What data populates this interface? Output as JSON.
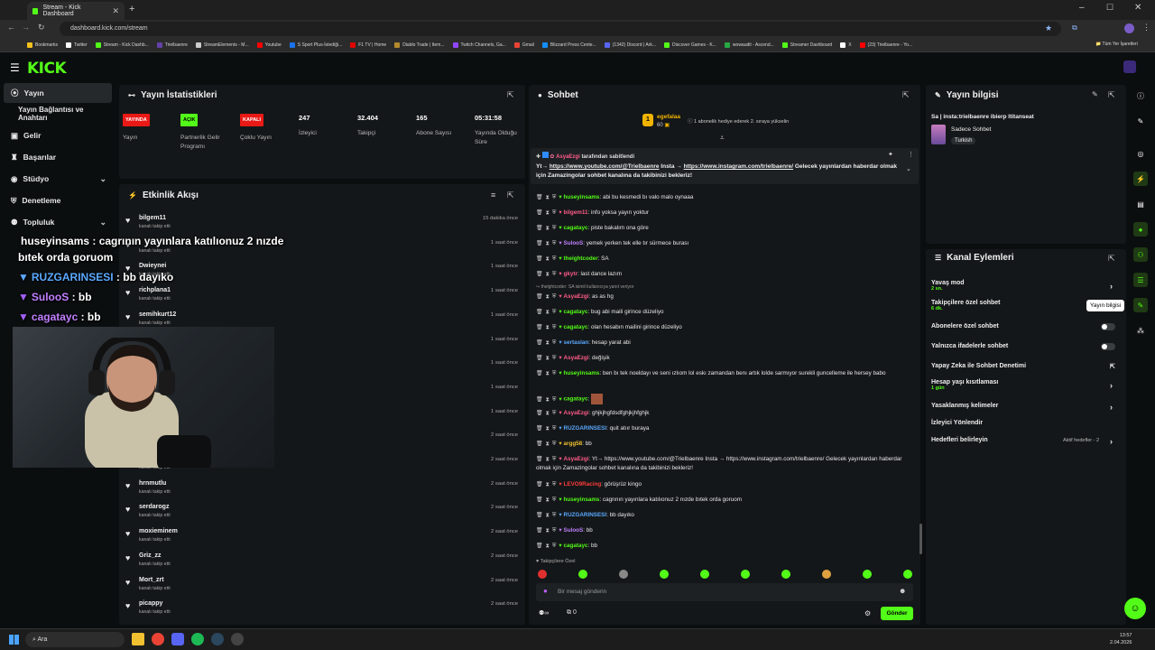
{
  "browser": {
    "tab_title": "Stream - Kick Dashboard",
    "url": "dashboard.kick.com/stream",
    "bookmarks": [
      "Bookmarks",
      "Twitter",
      "Stream - Kick Dashb...",
      "Trielbaenre",
      "StreamElements - M...",
      "Youtube",
      "S Sport Plus-İstediği...",
      "F1 TV | Home",
      "Diablo Trade | Item...",
      "Twitch Channels, Ga...",
      "Gmail",
      "Blizzard Press Cente...",
      "(1342) Discord | Ark...",
      "Discover Games - K...",
      "wowaudit - Ascend...",
      "Streamer Dashboard",
      "X",
      "(23) Trielbaenre - Yo..."
    ],
    "all_bookmarks": "Tüm Yer İşaretleri",
    "bookmark_colors": [
      "#f4c01e",
      "#ffffff",
      "#53fc18",
      "#6441a5",
      "#cccccc",
      "#ff0000",
      "#1a73e8",
      "#e10600",
      "#b48a2d",
      "#9146ff",
      "#ea4335",
      "#148eff",
      "#5865f2",
      "#53fc18",
      "#27a844",
      "#53fc18",
      "#ffffff",
      "#ff0000"
    ]
  },
  "app": {
    "logo": "KICK"
  },
  "sidebar": {
    "items": [
      {
        "label": "Yayın",
        "active": true
      },
      {
        "label": "Yayın Bağlantısı ve Anahtarı"
      },
      {
        "label": "Gelir"
      },
      {
        "label": "Başarılar"
      },
      {
        "label": "Stüdyo",
        "expand": "chevron-down"
      },
      {
        "label": "Denetleme"
      },
      {
        "label": "Topluluk",
        "expand": "chevron-down"
      }
    ]
  },
  "stats": {
    "title": "Yayın İstatistikleri",
    "items": [
      {
        "badge": "YAYINDA",
        "label": "Yayın",
        "badge_color": "#e91916"
      },
      {
        "badge": "AÇIK",
        "label": "Partnerlik Gelir Programı",
        "badge_color": "#53fc18"
      },
      {
        "badge": "KAPALI",
        "label": "Çoklu Yayın",
        "badge_color": "#e91916"
      },
      {
        "value": "247",
        "label": "İzleyici"
      },
      {
        "value": "32.404",
        "label": "Takipçi"
      },
      {
        "value": "165",
        "label": "Abone Sayısı"
      },
      {
        "value": "05:31:58",
        "label": "Yayında Olduğu Süre"
      }
    ]
  },
  "activity": {
    "title": "Etkinlik Akışı",
    "followed": "kanalı takip etti",
    "items": [
      {
        "name": "bilgem11",
        "time": "15 dakika önce"
      },
      {
        "name": "",
        "time": "1 saat önce"
      },
      {
        "name": "Dwieynei",
        "time": "1 saat önce"
      },
      {
        "name": "richplana1",
        "time": "1 saat önce"
      },
      {
        "name": "semihkurt12",
        "time": "1 saat önce"
      },
      {
        "name": "",
        "time": "1 saat önce"
      },
      {
        "name": "",
        "time": "1 saat önce"
      },
      {
        "name": "",
        "time": "1 saat önce"
      },
      {
        "name": "",
        "time": "1 saat önce"
      },
      {
        "name": "",
        "time": "2 saat önce"
      },
      {
        "name": "",
        "time": "2 saat önce"
      },
      {
        "name": "hrnmutlu",
        "time": "2 saat önce"
      },
      {
        "name": "serdarogz",
        "time": "2 saat önce"
      },
      {
        "name": "moxieminem",
        "time": "2 saat önce"
      },
      {
        "name": "Griz_zz",
        "time": "2 saat önce"
      },
      {
        "name": "Mort_zrt",
        "time": "2 saat önce"
      },
      {
        "name": "picappy",
        "time": "2 saat önce"
      }
    ]
  },
  "overlay": {
    "lines": [
      {
        "user": "huseyinsams",
        "text": " : cagrının yayınlara katılıonuz 2 nızde",
        "color": "#ffffff"
      },
      {
        "user": "",
        "text": "bıtek orda goruom",
        "color": "#ffffff"
      },
      {
        "user": "RUZGARINSESI",
        "text": " : bb dayıko",
        "color": "#5aa9ff"
      },
      {
        "user": "SulooS",
        "text": " : bb",
        "color": "#c080ff"
      },
      {
        "user": "cagatayc",
        "text": " : bb",
        "color": "#c080ff"
      }
    ]
  },
  "chat": {
    "title": "Sohbet",
    "gift": {
      "user": "egefalaa",
      "amount": "60",
      "text": "1 abonelik hediye ederek 2. sıraya yükselin"
    },
    "pinned": {
      "by": "AsyaEzgi",
      "label": "tarafından sabitlendi",
      "text_pre": "Yt→ ",
      "link1": "https://www.youtube.com/@Trielbaenre",
      "mid": " Insta → ",
      "link2": "https://www.instagram.com/trielbaenre/",
      "post": " Gelecek yayınlardan haberdar olmak için Zamazingolar sohbet kanalına da takibinizi bekleriz! "
    },
    "reply_note": "thelghtcoder: SA isimli kullanıcıya yanıt veriyor",
    "messages": [
      {
        "user": "huseyinsams",
        "color": "#53fc18",
        "text": "abi bu kesmedi bı valo malo oynaaa"
      },
      {
        "user": "bilgem11",
        "color": "#ff5c8a",
        "text": "info yoksa yayın yoktur"
      },
      {
        "user": "cagatayc",
        "color": "#53fc18",
        "text": "piste bakalım ona göre"
      },
      {
        "user": "SulooS",
        "color": "#c080ff",
        "text": "yemek yerken tek elle tır sürmece burası"
      },
      {
        "user": "theightcoder",
        "color": "#53fc18",
        "text": "SA"
      },
      {
        "user": "gkytr",
        "color": "#ff5c8a",
        "text": "last dance lazım"
      },
      {
        "user": "AsyaEzgi",
        "color": "#ff5c8a",
        "text": "as as hg"
      },
      {
        "user": "cagatayc",
        "color": "#53fc18",
        "text": "bug abi maili girince düzeliyo"
      },
      {
        "user": "cagatayc",
        "color": "#53fc18",
        "text": "olan hesabın mailini girince düzeliyo"
      },
      {
        "user": "sertaslan",
        "color": "#5aa9ff",
        "text": "hesap yarat abi"
      },
      {
        "user": "AsyaEzgi",
        "color": "#ff5c8a",
        "text": "değişik"
      },
      {
        "user": "huseyinsams",
        "color": "#53fc18",
        "text": "ben bı tek noeldayı ve seni ızlıom lol eskı zamandan benı artık lolde sarmıyor surekli guncelleme ile hersey babo"
      },
      {
        "user": "cagatayc",
        "color": "#53fc18",
        "text": ""
      },
      {
        "user": "AsyaEzgi",
        "color": "#ff5c8a",
        "text": "ghjkjhgfdsdfghjkjhfghjk"
      },
      {
        "user": "RUZGARINSESI",
        "color": "#5aa9ff",
        "text": "quit atıır buraya"
      },
      {
        "user": "argg58",
        "color": "#f0c030",
        "text": "bb"
      },
      {
        "user": "AsyaEzgi",
        "color": "#ff5c8a",
        "text": "Yt→ https://www.youtube.com/@Trielbaenre Insta → https://www.instagram.com/trielbaenre/ Gelecek yayınlardan haberdar olmak için Zamazingolar sohbet kanalına da takibinizi bekleriz!"
      },
      {
        "user": "LEVO9Racing",
        "color": "#ff3c3c",
        "text": "görüşrüz kingo"
      },
      {
        "user": "huseyinsams",
        "color": "#53fc18",
        "text": "cagrının yayınlara katılıonuz 2 nızde bıtek orda goruom"
      },
      {
        "user": "RUZGARINSESI",
        "color": "#5aa9ff",
        "text": "bb dayıko"
      },
      {
        "user": "SulooS",
        "color": "#c080ff",
        "text": "bb"
      },
      {
        "user": "cagatayc",
        "color": "#53fc18",
        "text": "bb"
      }
    ],
    "mode_note": "Takipçilere Özel",
    "input_placeholder": "Bir mesaj gönderin",
    "count": "0",
    "send": "Gönder"
  },
  "info": {
    "title": "Yayın bilgisi",
    "stream_title": "Sa | insta:trielbaenre ibierp ltitanseat",
    "category": "Sadece Sohbet",
    "tag": "Turkish"
  },
  "channel": {
    "title": "Kanal Eylemleri",
    "rows": [
      {
        "label": "Yavaş mod",
        "sub": "2 sn.",
        "ctrl": "chevron-right"
      },
      {
        "label": "Takipçilere özel sohbet",
        "sub": "6 dk.",
        "ctrl": ""
      },
      {
        "label": "Abonelere özel sohbet",
        "sub": "",
        "ctrl": "toggle"
      },
      {
        "label": "Yalnızca ifadelerle sohbet",
        "sub": "",
        "ctrl": "toggle"
      },
      {
        "label": "Yapay Zeka ile Sohbet Denetimi",
        "sub": "",
        "ctrl": "external"
      },
      {
        "label": "Hesap yaşı kısıtlaması",
        "sub": "1 gün",
        "ctrl": "chevron-right"
      },
      {
        "label": "Yasaklanmış kelimeler",
        "sub": "",
        "ctrl": "chevron-right"
      },
      {
        "label": "İzleyici Yönlendir",
        "sub": "",
        "ctrl": ""
      },
      {
        "label": "Hedefleri belirleyin",
        "sub": "",
        "ctrl": "chevron-right",
        "note": "Aktif hedefler - 2"
      }
    ],
    "tooltip": "Yayın bilgisi"
  },
  "taskbar": {
    "search": "Ara",
    "time": "13:57",
    "date": "2.04.2026"
  }
}
